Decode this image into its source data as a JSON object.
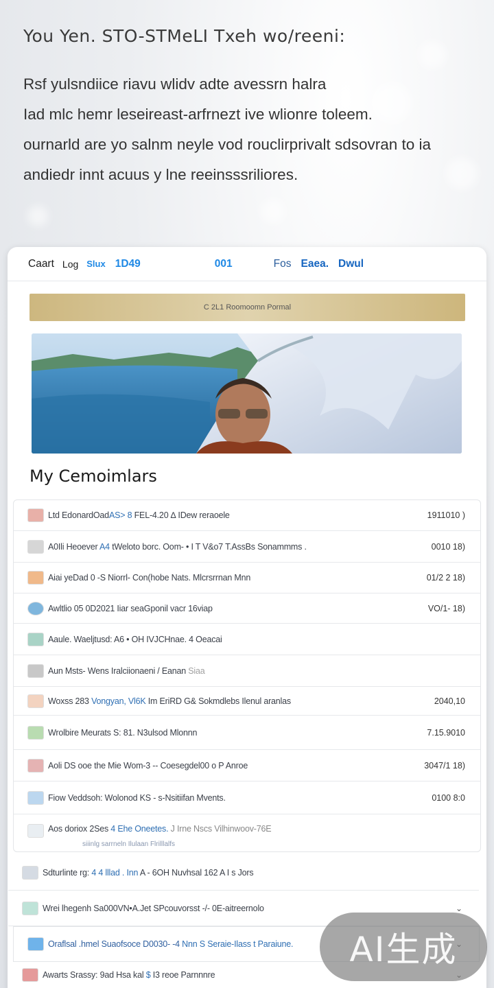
{
  "intro": {
    "title": "You Yen. STO-STMeLI  Txeh wo/reeni:",
    "lines": [
      "Rsf yulsndiice riavu wlidv adte avessrn halra",
      "Iad mlc hemr leseireast-arfrnezt ive wlionre toleem.",
      "ournarld are yo salnm neyle vod rouclirprivalt sdsovran to ia",
      "andiedr innt acuus y lne reeinsssriliores."
    ]
  },
  "nav": {
    "items": [
      "Caart",
      "Log",
      "Slux",
      "1D49",
      "001",
      "Fos",
      "Eaea.",
      "Dwul"
    ]
  },
  "banner": {
    "text": "C 2L1 Roomoomn Pormal"
  },
  "section": {
    "title": "My Cemoimlars"
  },
  "rows": [
    {
      "text": "Ltd EdonardOad",
      "hl": "AS> 8 ",
      "rest": "FEL-4.20 ∆ IDew reraoele",
      "value": "1911010 )",
      "icon_color": "#c0392b"
    },
    {
      "text": "A0Ili Heoever ",
      "hl": "A4 ",
      "rest": "tWeloto borc. Oom- • I T V&o7 T.AssBs Sonammms .",
      "value": "0010 18)",
      "icon_color": "#888888"
    },
    {
      "text": "Aiai yeDad 0 -",
      "hl": "",
      "rest": "S Niorrl- Con(hobe Nats. Mlcrsrrnan Mnn",
      "value": "01/2 2 18)",
      "icon_color": "#d35400"
    },
    {
      "text": "Awltlio 05 0D2021 Iiar seaGpon",
      "hl": "",
      "rest": "il vacr 16viap",
      "value": "VO/1- 18)",
      "icon_color": "#2e86c1"
    },
    {
      "text": "Aaule. Waeljtusd: ",
      "hl": "",
      "rest": "A6 • OH IVJCHnae.    4 Oeacai",
      "value": "",
      "icon_color": "#16a085"
    },
    {
      "text": "Aun Msts- Wens Iralciionaeni / Eanan ",
      "hl": "",
      "rest": "Siaa",
      "value": "",
      "icon_color": "#7f8c8d"
    },
    {
      "text": "Woxss 283 ",
      "hl": "Vongyan, Vl6K",
      "rest": " Im EriRD G& Sokmdlebs Ilenul aranlas",
      "value": "2040,10",
      "icon_color": "#e67e22"
    },
    {
      "text": "Wrolbire Meurats ",
      "hl": "",
      "rest": "  S: 81. N3ulsod Mlonnn",
      "value": "7.15.9010",
      "icon_color": "#27ae60"
    },
    {
      "text": "Aoli DS ooe ",
      "hl": "",
      "rest": "the Mie Wom-3 -- Coesegdel00 o P Anroe",
      "value": "3047/1 18)",
      "icon_color": "#c0392b"
    },
    {
      "text": "Fiow Veddsoh: ",
      "hl": "",
      "rest": "Wolonod KS - s-Nsitiifan Mvents.",
      "value": "0100 8:0",
      "icon_color": "#5dade2"
    },
    {
      "text": "Aos doriox 2Ses ",
      "hl": "4 Ehe Oneetes.",
      "rest": "   J Irne Nscs Vilhinwoov-76E",
      "value": "",
      "icon_color": "#aab7b8",
      "sub": "siiinlg sarrneln  Ilulaan  Flrilllalfs"
    }
  ],
  "outer_rows": [
    {
      "text": "Sdturlinte rg: ",
      "hl": "4 4 lllad . Inn",
      "rest": " A - 6OH Nuvhsal 162 A I s Jors",
      "chev": "",
      "icon_color": "#5d6d7e"
    },
    {
      "text": "Wrei lhegenh Sa000VN•A.Jet SPcouvorsst -/- 0E-aitreernolo",
      "hl": "",
      "rest": "",
      "chev": "⌄",
      "icon_color": "#1abc9c"
    },
    {
      "text": "Oraflsal .hmel Suaofsoce D0030- -4",
      "hl": " Nnn S ",
      "rest": "Seraie-Ilass t Paraiune.",
      "chev": "⌄",
      "icon_color": "#3498db"
    },
    {
      "text": "Awarts Srassy: 9ad Hsa kal ",
      "hl": "$ ",
      "rest": "I3  reoe Parnnnre",
      "chev": "⌄",
      "icon_color": "#c0392b"
    }
  ],
  "watermark": {
    "text": "AI生成"
  }
}
